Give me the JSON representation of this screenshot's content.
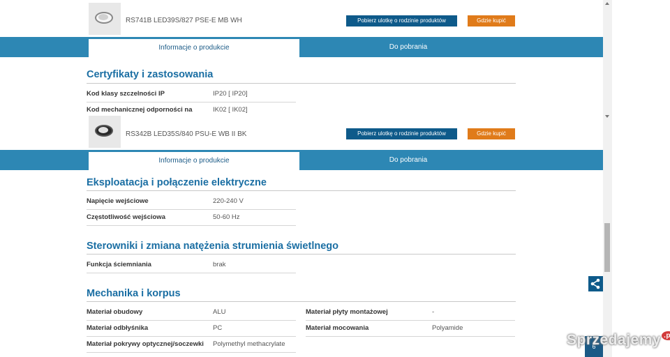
{
  "products": [
    {
      "name": "RS741B LED39S/827 PSE-E MB WH",
      "leaflet_label": "Pobierz ulotkę o rodzinie produktów",
      "buy_label": "Gdzie kupić",
      "tabs": {
        "info": "Informacje o produkcie",
        "download": "Do pobrania"
      },
      "thumb_icon": "recessed-downlight-white"
    },
    {
      "name": "RS342B LED35S/840 PSU-E WB II BK",
      "leaflet_label": "Pobierz ulotkę o rodzinie produktów",
      "buy_label": "Gdzie kupić",
      "tabs": {
        "info": "Informacje o produkcie",
        "download": "Do pobrania"
      },
      "thumb_icon": "recessed-downlight-black"
    }
  ],
  "sections": {
    "certs": {
      "title": "Certyfikaty i zastosowania",
      "rows": [
        {
          "label": "Kod klasy szczelności IP",
          "value": "IP20  [ IP20]"
        },
        {
          "label": "Kod mechanicznej odporności na",
          "value": "IK02  [ IK02]"
        }
      ]
    },
    "electrical": {
      "title": "Eksploatacja i połączenie elektryczne",
      "rows": [
        {
          "label": "Napięcie wejściowe",
          "value": "220-240 V"
        },
        {
          "label": "Częstotliwość wejściowa",
          "value": "50-60 Hz"
        }
      ]
    },
    "dimming": {
      "title": "Sterowniki i zmiana natężenia strumienia świetlnego",
      "rows": [
        {
          "label": "Funkcja ściemniania",
          "value": "brak"
        }
      ]
    },
    "mechanics": {
      "title": "Mechanika i korpus",
      "left_rows": [
        {
          "label": "Materiał obudowy",
          "value": "ALU"
        },
        {
          "label": "Materiał odbłyśnika",
          "value": "PC"
        },
        {
          "label": "Materiał pokrywy optycznej/soczewki",
          "value": "Polymethyl methacrylate"
        }
      ],
      "right_rows": [
        {
          "label": "Materiał płyty montażowej",
          "value": "-"
        },
        {
          "label": "Materiał mocowania",
          "value": "Polyamide"
        }
      ]
    }
  },
  "share_icon": "share-icon",
  "chip_text": "6",
  "watermark": {
    "text": "Sprzedajemy",
    "suffix": ".pl"
  },
  "colors": {
    "tab_bar": "#2d87b4",
    "leaflet_button": "#0e5a8a",
    "buy_button": "#e07b1a",
    "section_title": "#1a6ea3"
  }
}
